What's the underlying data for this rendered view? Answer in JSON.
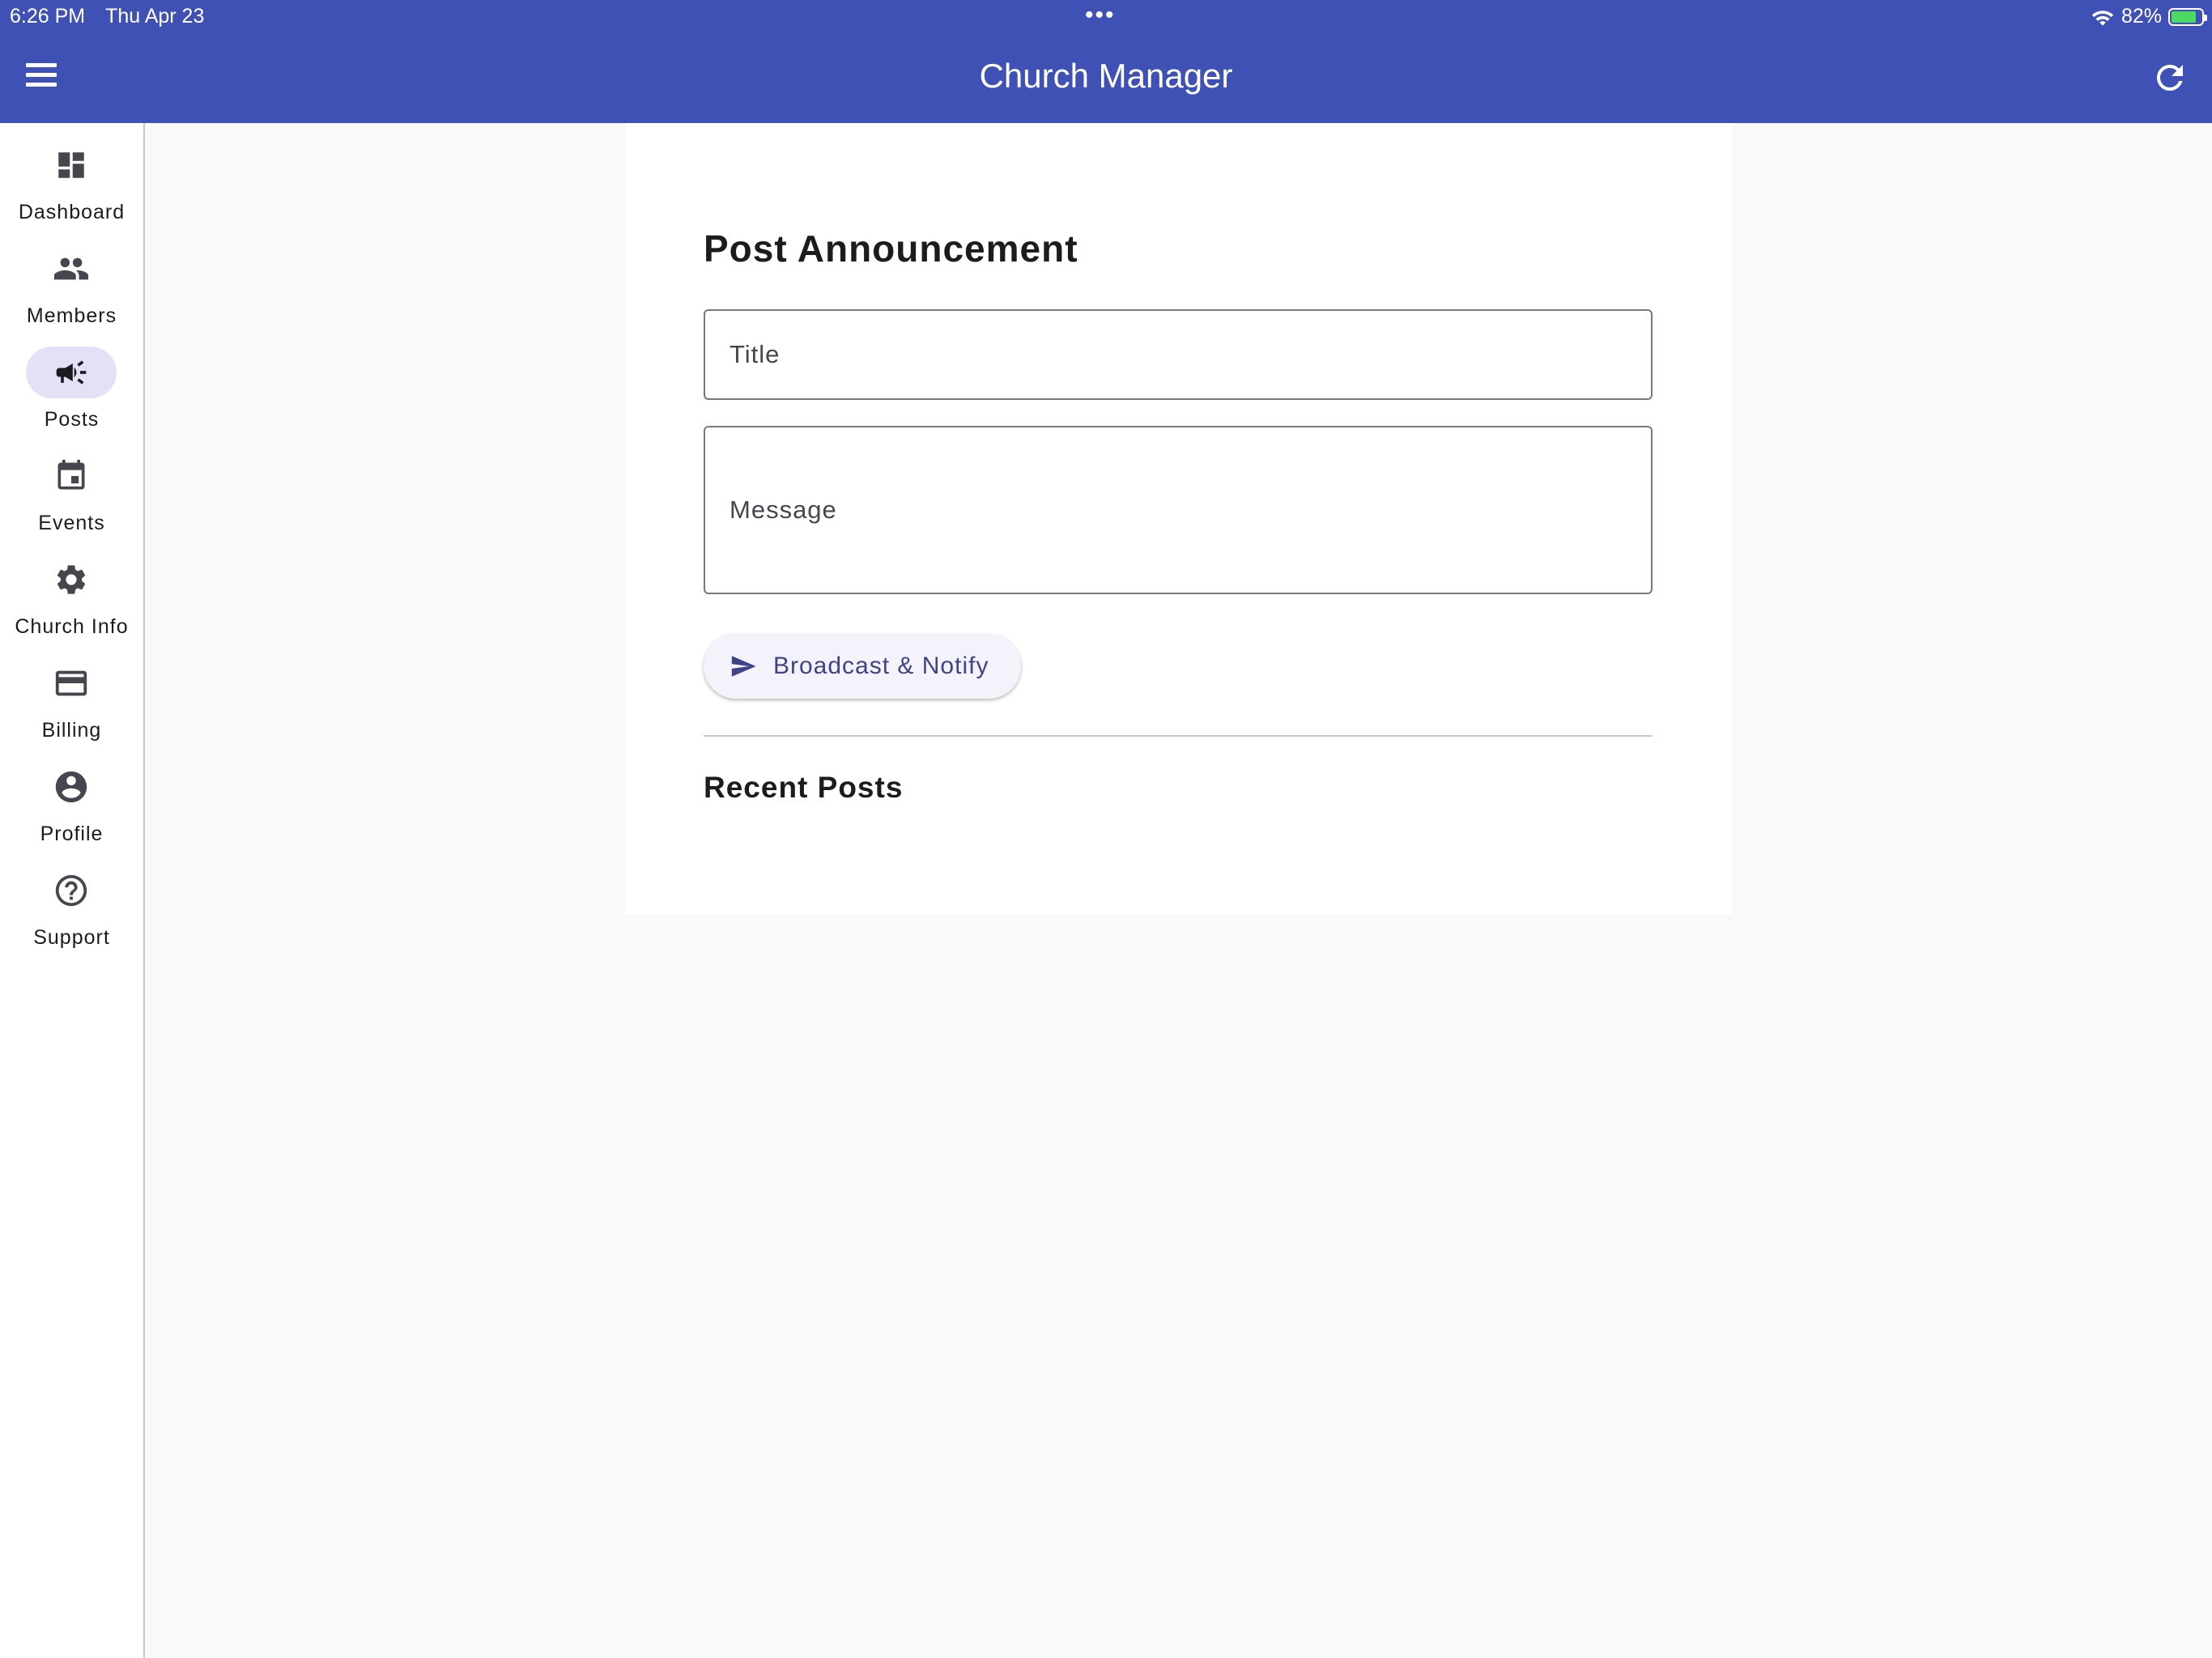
{
  "status_bar": {
    "time": "6:26 PM",
    "date": "Thu Apr 23",
    "multitask_dots": "•••",
    "battery_percent": "82%",
    "battery_level": 0.82
  },
  "app_bar": {
    "title": "Church Manager",
    "menu_icon": "hamburger-menu-icon",
    "refresh_icon": "refresh-icon"
  },
  "colors": {
    "app_bar": "#3f51b5",
    "active_indicator": "#e3e1f5",
    "button_text": "#3e4485",
    "background": "#f9f9f9"
  },
  "nav": {
    "active": "Posts",
    "items": [
      {
        "label": "Dashboard",
        "icon": "dashboard-icon"
      },
      {
        "label": "Members",
        "icon": "people-icon"
      },
      {
        "label": "Posts",
        "icon": "campaign-megaphone-icon"
      },
      {
        "label": "Events",
        "icon": "calendar-event-icon"
      },
      {
        "label": "Church Info",
        "icon": "gear-icon"
      },
      {
        "label": "Billing",
        "icon": "credit-card-icon"
      },
      {
        "label": "Profile",
        "icon": "account-circle-icon"
      },
      {
        "label": "Support",
        "icon": "help-circle-icon"
      }
    ]
  },
  "post_form": {
    "heading": "Post Announcement",
    "title_placeholder": "Title",
    "title_value": "",
    "message_placeholder": "Message",
    "message_value": "",
    "submit_label": "Broadcast & Notify",
    "submit_icon": "send-icon"
  },
  "recent_posts": {
    "heading": "Recent Posts",
    "items": []
  }
}
